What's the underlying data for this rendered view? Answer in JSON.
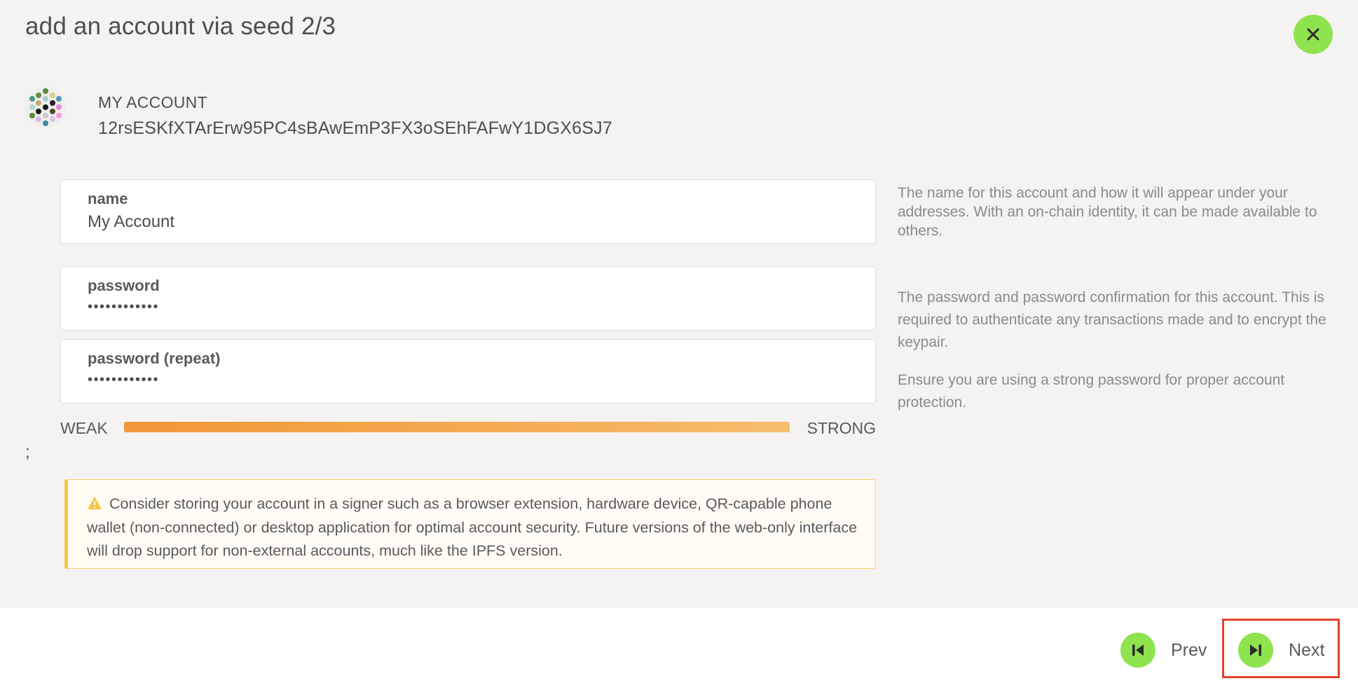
{
  "title": "add an account via seed 2/3",
  "account": {
    "name": "MY ACCOUNT",
    "address": "12rsESKfXTArErw95PC4sBAwEmP3FX3oSEhFAFwY1DGX6SJ7"
  },
  "form": {
    "name_label": "name",
    "name_value": "My Account",
    "password_label": "password",
    "password_value": "••••••••••••",
    "password_repeat_label": "password (repeat)",
    "password_repeat_value": "••••••••••••"
  },
  "help": {
    "name": "The name for this account and how it will appear under your addresses. With an on-chain identity, it can be made available to others.",
    "password": "The password and password confirmation for this account. This is required to authenticate any transactions made and to encrypt the keypair.",
    "strength": "Ensure you are using a strong password for proper account protection."
  },
  "strength": {
    "weak_label": "WEAK",
    "strong_label": "STRONG",
    "level": 1.0
  },
  "stray_text": ";",
  "warning": {
    "text": "Consider storing your account in a signer such as a browser extension, hardware device, QR-capable phone wallet (non-connected) or desktop application for optimal account security. Future versions of the web-only interface will drop support for non-external accounts, much like the IPFS version."
  },
  "footer": {
    "prev_label": "Prev",
    "next_label": "Next"
  },
  "colors": {
    "accent": "#8fe34f",
    "highlight": "#e2432a",
    "warning_border": "#f5c53e",
    "strength_bar": "#f4ad56"
  },
  "icons": {
    "close": "close-icon",
    "prev": "skip-back-icon",
    "next": "skip-forward-icon",
    "warning": "warning-triangle-icon"
  }
}
